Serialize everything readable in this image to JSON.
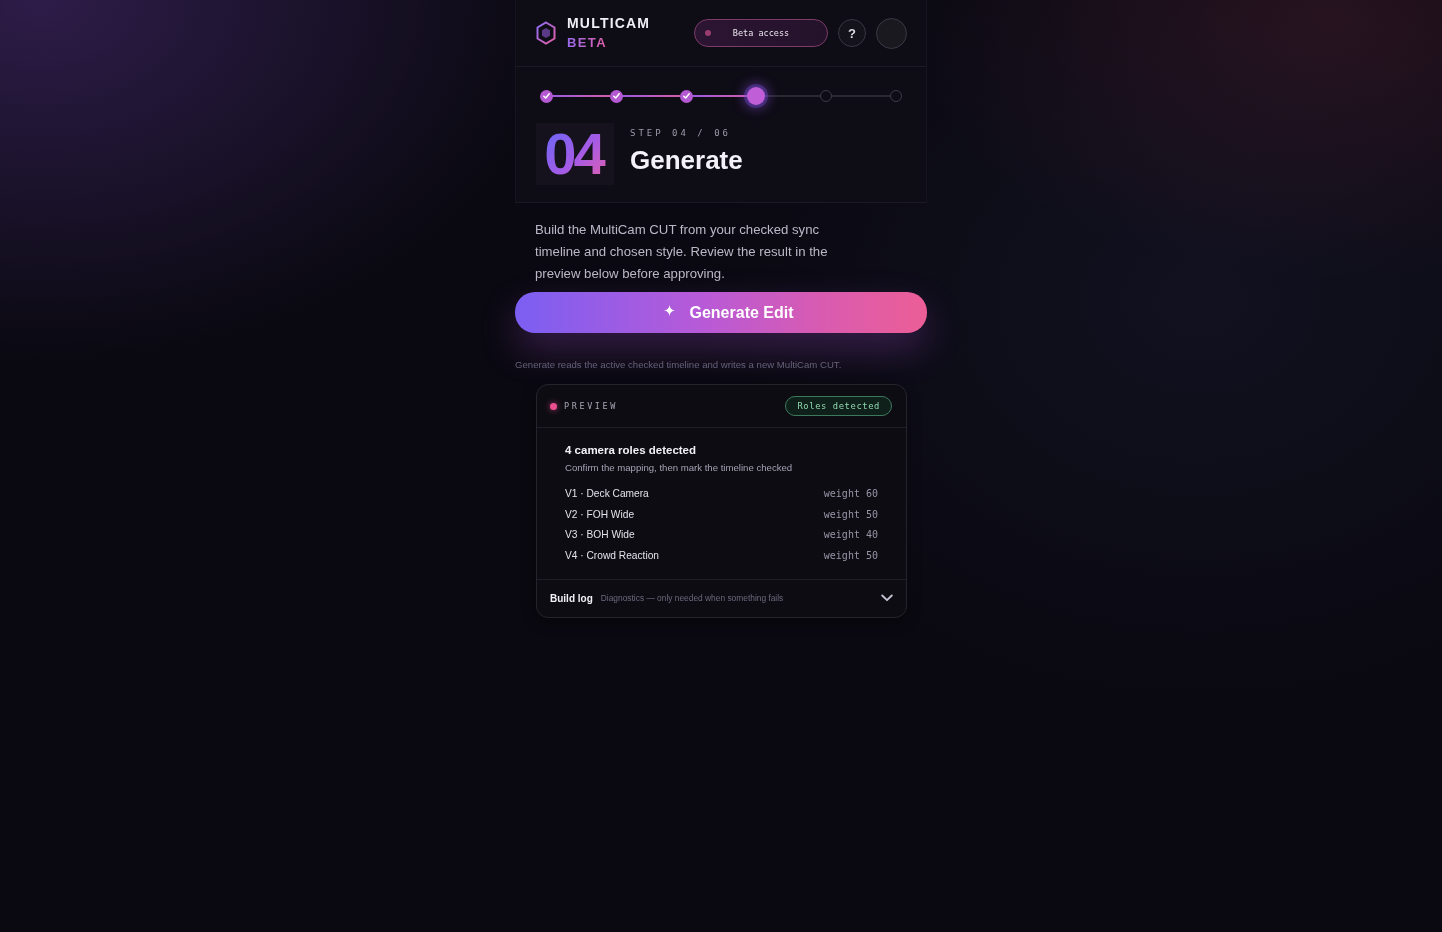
{
  "header": {
    "brand": "MULTICAM",
    "edition": "BETA",
    "access_pill": {
      "label": "Beta access"
    },
    "help_button": {
      "label": "?"
    }
  },
  "stepper": {
    "steps": [
      {
        "done": true,
        "selected": false
      },
      {
        "done": true,
        "selected": false
      },
      {
        "done": true,
        "selected": false
      },
      {
        "done": false,
        "selected": true
      },
      {
        "done": false,
        "selected": false
      },
      {
        "done": false,
        "selected": false
      }
    ]
  },
  "step": {
    "number": "04",
    "counter": "STEP 04 / 06",
    "title": "Generate"
  },
  "description": "Build the MultiCam CUT from your checked sync timeline and chosen style. Review the result in the preview below before approving.",
  "primary_button": {
    "label": "Generate Edit"
  },
  "helper_text": "Generate reads the active checked timeline and writes a new MultiCam CUT.",
  "preview": {
    "label": "PREVIEW",
    "status_badge": "Roles detected",
    "heading": "4 camera roles detected",
    "subheading": "Confirm the mapping, then mark the timeline checked",
    "roles": [
      {
        "name": "V1 · Deck Camera",
        "weight": "weight 60"
      },
      {
        "name": "V2 · FOH Wide",
        "weight": "weight 50"
      },
      {
        "name": "V3 · BOH Wide",
        "weight": "weight 40"
      },
      {
        "name": "V4 · Crowd Reaction",
        "weight": "weight 50"
      }
    ],
    "build_log": {
      "label": "Build log",
      "hint": "Diagnostics — only needed when something fails",
      "expanded": false
    }
  }
}
